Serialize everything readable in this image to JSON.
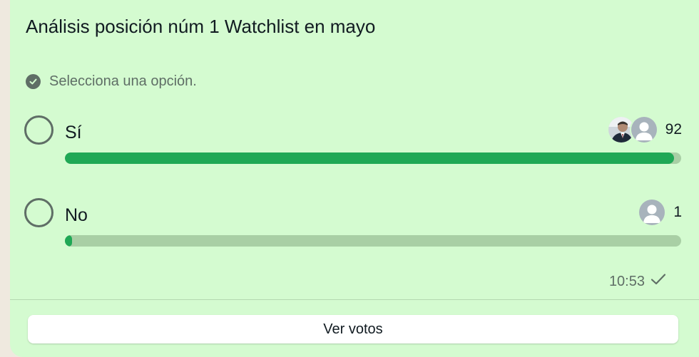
{
  "poll": {
    "title": "Análisis posición núm 1 Watchlist en mayo",
    "hint": "Selecciona una opción.",
    "options": [
      {
        "label": "Sí",
        "votes": "92",
        "fraction": 0.989,
        "avatars": [
          "photo-avatar",
          "default-avatar"
        ]
      },
      {
        "label": "No",
        "votes": "1",
        "fraction": 0.011,
        "avatars": [
          "default-avatar"
        ]
      }
    ],
    "timestamp": "10:53",
    "status_icon": "single-check-icon",
    "view_votes_label": "Ver votos"
  },
  "colors": {
    "card_bg": "#d4fbd0",
    "progress_fill": "#1fa855",
    "progress_track": "#a9cfa5",
    "muted_text": "#5f6e66"
  }
}
